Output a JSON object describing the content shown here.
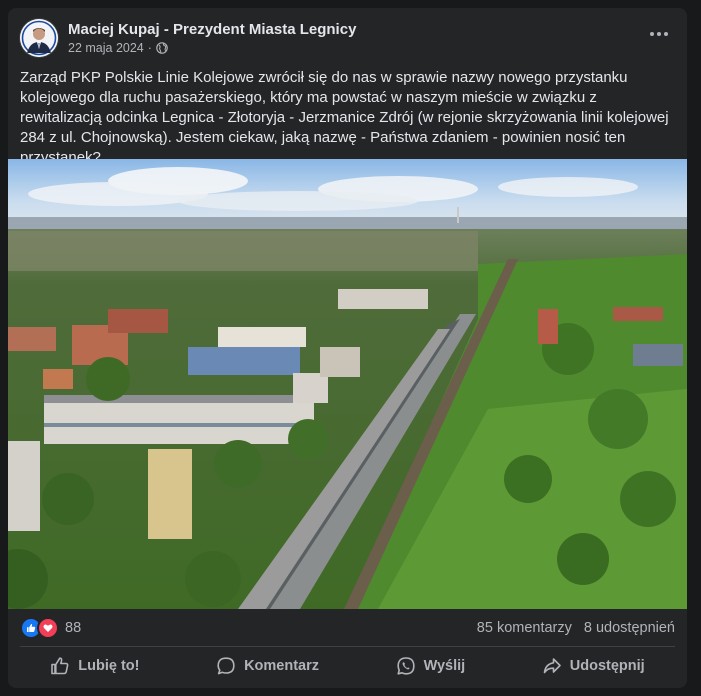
{
  "post": {
    "author": "Maciej Kupaj - Prezydent Miasta Legnicy",
    "date": "22 maja 2024",
    "date_separator": "·",
    "privacy_icon": "globe-icon",
    "text": "Zarząd PKP Polskie Linie Kolejowe zwrócił się do nas w sprawie nazwy nowego przystanku kolejowego dla ruchu pasażerskiego, który ma powstać w naszym mieście w związku z rewitalizacją odcinka Legnica - Złotoryja - Jerzmanice Zdrój (w rejonie skrzyżowania linii kolejowej 284 z ul. Chojnowską). Jestem ciekaw, jaką nazwę - Państwa zdaniem - powinien nosić ten przystanek?"
  },
  "stats": {
    "reactions_count": "88",
    "reaction_icons": [
      "like-icon",
      "heart-icon"
    ],
    "comments": "85 komentarzy",
    "shares": "8 udostępnień"
  },
  "actions": {
    "like": "Lubię to!",
    "comment": "Komentarz",
    "send": "Wyślij",
    "share": "Udostępnij"
  },
  "colors": {
    "background": "#18191a",
    "card": "#242526",
    "text_primary": "#e4e6eb",
    "text_secondary": "#b0b3b8",
    "like_blue": "#1877f2",
    "heart_red": "#f33e58"
  }
}
